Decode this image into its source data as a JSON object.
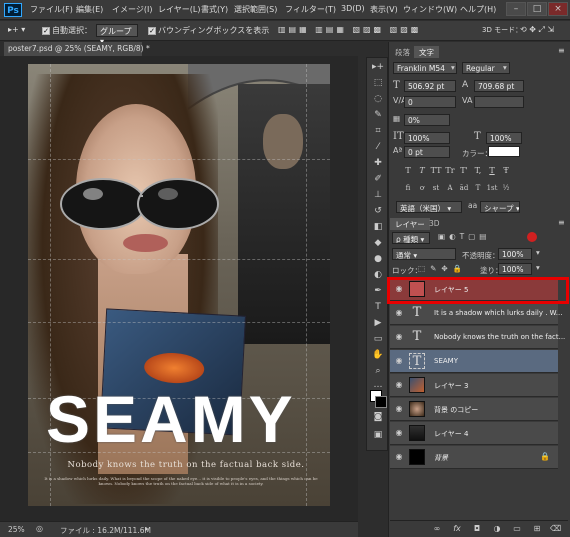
{
  "app": {
    "logo": "Ps"
  },
  "menu": {
    "items": [
      "ファイル(F)",
      "編集(E)",
      "イメージ(I)",
      "レイヤー(L)",
      "書式(Y)",
      "選択範囲(S)",
      "フィルター(T)",
      "3D(D)",
      "表示(V)",
      "ウィンドウ(W)",
      "ヘルプ(H)"
    ]
  },
  "options": {
    "auto_select": "自動選択：",
    "auto_select_value": "グループ",
    "bounding_box": "バウンディングボックスを表示",
    "mode_3d": "3D モード："
  },
  "document": {
    "tab_title": "poster7.psd @ 25% (SEAMY, RGB/8) *",
    "zoom": "25%",
    "file_info": "ファイル : 16.2M/111.6M"
  },
  "poster": {
    "title": "SEAMY",
    "subtitle": "Nobody knows the truth on the factual back side.",
    "paragraph": "It is a shadow which lurks daily. What is beyond the scope of the naked eye... it is visible to people's eyes, and the things which can be known. Nobody knows the truth on the factual back side of what it is in a society."
  },
  "character_panel": {
    "tabs": [
      "段落",
      "文字"
    ],
    "font_family": "Franklin M54",
    "font_style": "Regular",
    "font_size": "506.92 pt",
    "leading": "709.68 pt",
    "kerning": "0",
    "tracking": "",
    "scale_pct": "0%",
    "vscale": "100%",
    "hscale": "100%",
    "baseline": "0 pt",
    "color_label": "カラー：",
    "language": "英語（米国）",
    "aa": "シャープ",
    "style_buttons": [
      "T",
      "T",
      "TT",
      "Tr",
      "T'",
      "T,",
      "T",
      "Ŧ"
    ],
    "style_buttons2": [
      "fi",
      "ơ",
      "st",
      "A",
      "ād",
      "T",
      "1st",
      "½"
    ]
  },
  "layers_panel": {
    "tabs": [
      "レイヤー",
      "3D"
    ],
    "kind_label": "ρ 種類",
    "blend_mode": "通常",
    "opacity_label": "不透明度：",
    "opacity": "100%",
    "lock_label": "ロック：",
    "fill_label": "塗り：",
    "fill": "100%",
    "layers": [
      {
        "name": "レイヤー 5",
        "type": "pixel",
        "state": "selected-red",
        "thumb_color": "#c05050"
      },
      {
        "name": "It is a shadow which lurks daily . W...",
        "type": "text",
        "state": "normal",
        "thumb_color": ""
      },
      {
        "name": "Nobody knows the truth on the fact...",
        "type": "text",
        "state": "normal",
        "thumb_color": ""
      },
      {
        "name": "SEAMY",
        "type": "text",
        "state": "active",
        "thumb_color": ""
      },
      {
        "name": "レイヤー 3",
        "type": "pixel",
        "state": "normal",
        "thumb_color": "#3a5070"
      },
      {
        "name": "背景 のコピー",
        "type": "pixel",
        "state": "normal",
        "thumb_color": "#5a4a40"
      },
      {
        "name": "レイヤー 4",
        "type": "pixel",
        "state": "normal",
        "thumb_color": "#303030"
      },
      {
        "name": "背景",
        "type": "pixel",
        "state": "locked",
        "thumb_color": "#000000"
      }
    ]
  },
  "colors": {
    "highlight_box": "#e80000",
    "selected_layer": "#8a3a3a",
    "active_layer": "#5a6a80"
  }
}
